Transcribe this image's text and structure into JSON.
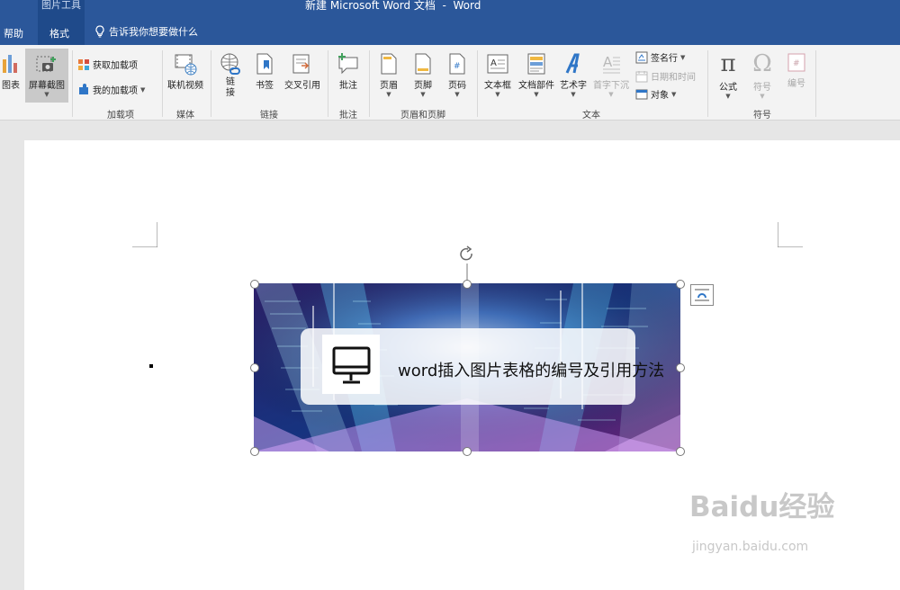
{
  "window": {
    "contextual_group": "图片工具",
    "document_title": "新建 Microsoft Word 文档  -  Word"
  },
  "tabs": {
    "help": "帮助",
    "format": "格式",
    "tell_me": "告诉我你想要做什么"
  },
  "ribbon": {
    "illustrations": {
      "chart": "图表",
      "screenshot": "屏幕截图"
    },
    "addins": {
      "get_addins": "获取加载项",
      "my_addins": "我的加载项",
      "label": "加载项"
    },
    "media": {
      "online_video": "联机视频",
      "label": "媒体"
    },
    "links": {
      "link": "链\n接",
      "bookmark": "书签",
      "cross_reference": "交叉引用",
      "label": "链接"
    },
    "comments": {
      "comment": "批注",
      "label": "批注"
    },
    "header_footer": {
      "header": "页眉",
      "footer": "页脚",
      "page_number": "页码",
      "label": "页眉和页脚"
    },
    "text": {
      "text_box": "文本框",
      "quick_parts": "文档部件",
      "wordart": "艺术字",
      "drop_cap": "首字下沉",
      "signature_line": "签名行",
      "date_time": "日期和时间",
      "object": "对象",
      "label": "文本"
    },
    "symbols": {
      "equation": "公式",
      "symbol": "符号",
      "number": "编号",
      "label": "符号"
    }
  },
  "image": {
    "caption": "word插入图片表格的编号及引用方法",
    "icon": "monitor-icon"
  },
  "watermark": {
    "brand": "Baidu经验",
    "url": "jingyan.baidu.com"
  },
  "colors": {
    "titlebar": "#2b579a",
    "ribbon": "#f3f3f3",
    "canvas": "#e6e6e6"
  }
}
